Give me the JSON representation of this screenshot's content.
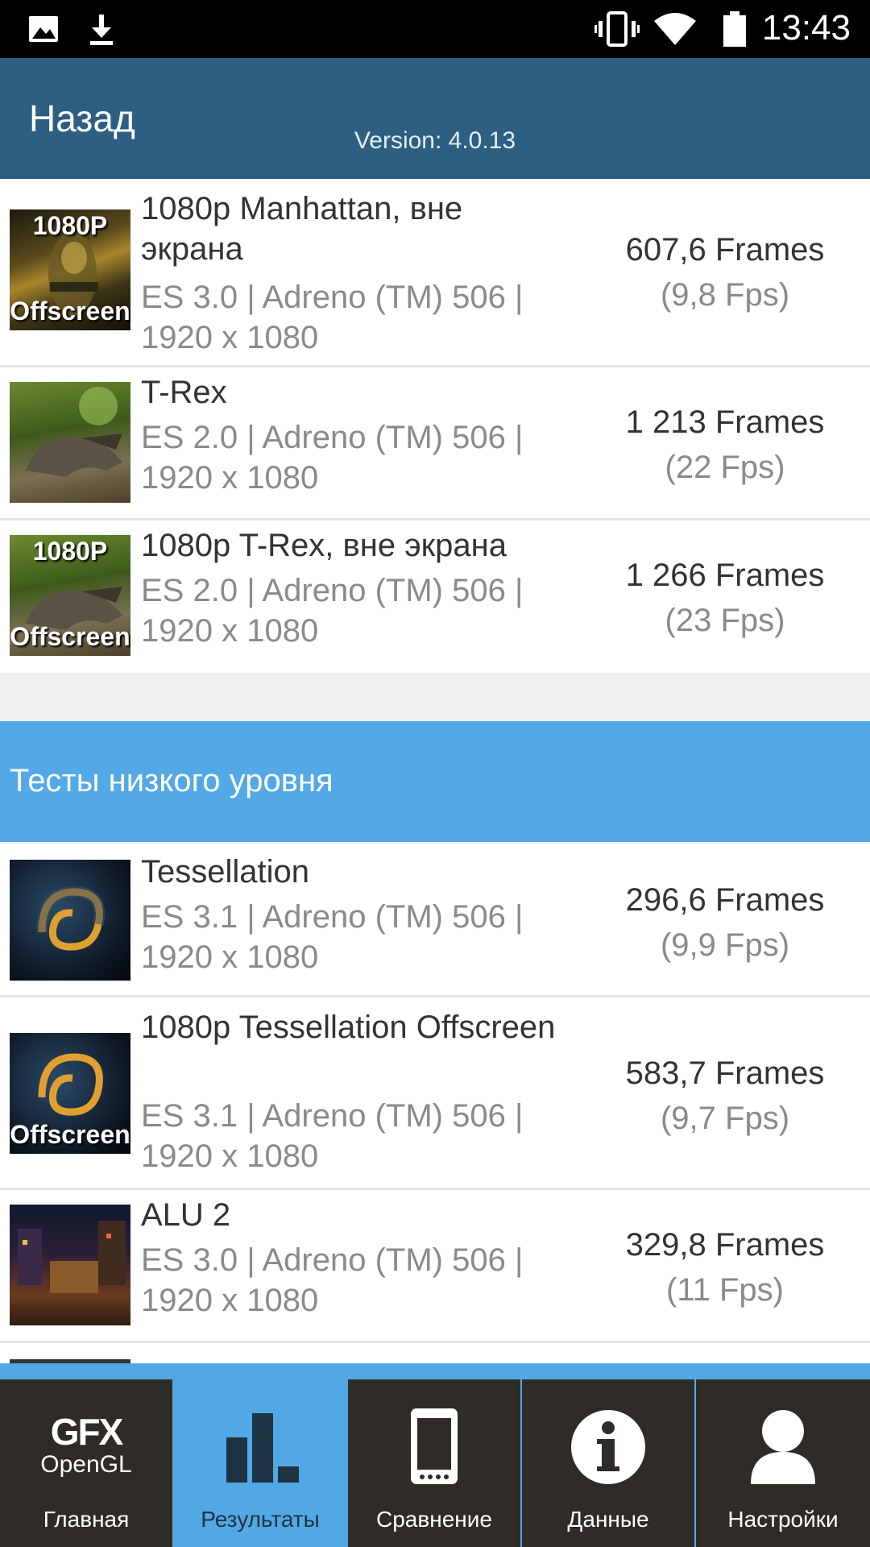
{
  "status_bar": {
    "time": "13:43",
    "left_icons": [
      "image-icon",
      "download-icon"
    ],
    "right_icons": [
      "vibrate-icon",
      "wifi-icon",
      "battery-icon"
    ]
  },
  "header": {
    "back_label": "Назад",
    "version": "Version: 4.0.13"
  },
  "tests_top": [
    {
      "name": "1080p Manhattan, вне экрана",
      "api": "ES 3.0 | Adreno (TM) 506 | 1920 x 1080",
      "frames": "607,6 Frames",
      "fps": "(9,8 Fps)",
      "thumb_text_top": "1080P",
      "thumb_text_bottom": "Offscreen"
    },
    {
      "name": "T-Rex",
      "api": "ES 2.0 | Adreno (TM) 506 | 1920 x 1080",
      "frames": "1 213 Frames",
      "fps": "(22 Fps)"
    },
    {
      "name": "1080p T-Rex, вне экрана",
      "api": "ES 2.0 | Adreno (TM) 506 | 1920 x 1080",
      "frames": "1 266 Frames",
      "fps": "(23 Fps)",
      "thumb_text_top": "1080P",
      "thumb_text_bottom": "Offscreen"
    }
  ],
  "section_low_level": {
    "title": "Тесты низкого уровня"
  },
  "tests_low": [
    {
      "name": "Tessellation",
      "api": "ES 3.1 | Adreno (TM) 506 | 1920 x 1080",
      "frames": "296,6 Frames",
      "fps": "(9,9 Fps)"
    },
    {
      "name": "1080p Tessellation Offscreen",
      "api": "ES 3.1 | Adreno (TM) 506 | 1920 x 1080",
      "frames": "583,7 Frames",
      "fps": "(9,7 Fps)",
      "thumb_text_bottom": "Offscreen"
    },
    {
      "name": "ALU 2",
      "api": "ES 3.0 | Adreno (TM) 506 | 1920 x 1080",
      "frames": "329,8 Frames",
      "fps": "(11 Fps)"
    }
  ],
  "tabs": [
    {
      "label": "Главная",
      "icon": "gfx-logo-icon",
      "logo_top": "GFX",
      "logo_bottom": "OpenGL"
    },
    {
      "label": "Результаты",
      "icon": "bar-chart-icon",
      "active": true
    },
    {
      "label": "Сравнение",
      "icon": "phone-icon"
    },
    {
      "label": "Данные",
      "icon": "info-icon"
    },
    {
      "label": "Настройки",
      "icon": "user-icon"
    }
  ],
  "colors": {
    "appbar": "#2c5f82",
    "section": "#53a9e5",
    "tab_active": "#52a8e4",
    "tab_inactive": "#2f2b27"
  }
}
